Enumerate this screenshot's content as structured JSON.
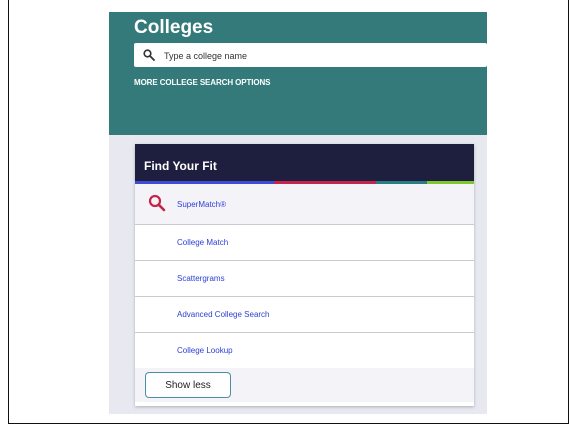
{
  "hero": {
    "title": "Colleges",
    "search_placeholder": "Type a college name",
    "more_options": "MORE COLLEGE SEARCH OPTIONS"
  },
  "fit": {
    "title": "Find Your Fit",
    "stripe_colors": [
      "#3f4ad6",
      "#c4254a",
      "#2a7d83",
      "#7ec72c"
    ],
    "items": [
      {
        "label": "SuperMatch®",
        "icon": "search-icon"
      },
      {
        "label": "College Match"
      },
      {
        "label": "Scattergrams"
      },
      {
        "label": "Advanced College Search"
      },
      {
        "label": "College Lookup"
      }
    ],
    "show_less": "Show less"
  },
  "colors": {
    "hero_bg": "#357a7b",
    "header_bg": "#1e1e3f",
    "link": "#2c3ed6",
    "supermatch_icon": "#c4254a"
  }
}
